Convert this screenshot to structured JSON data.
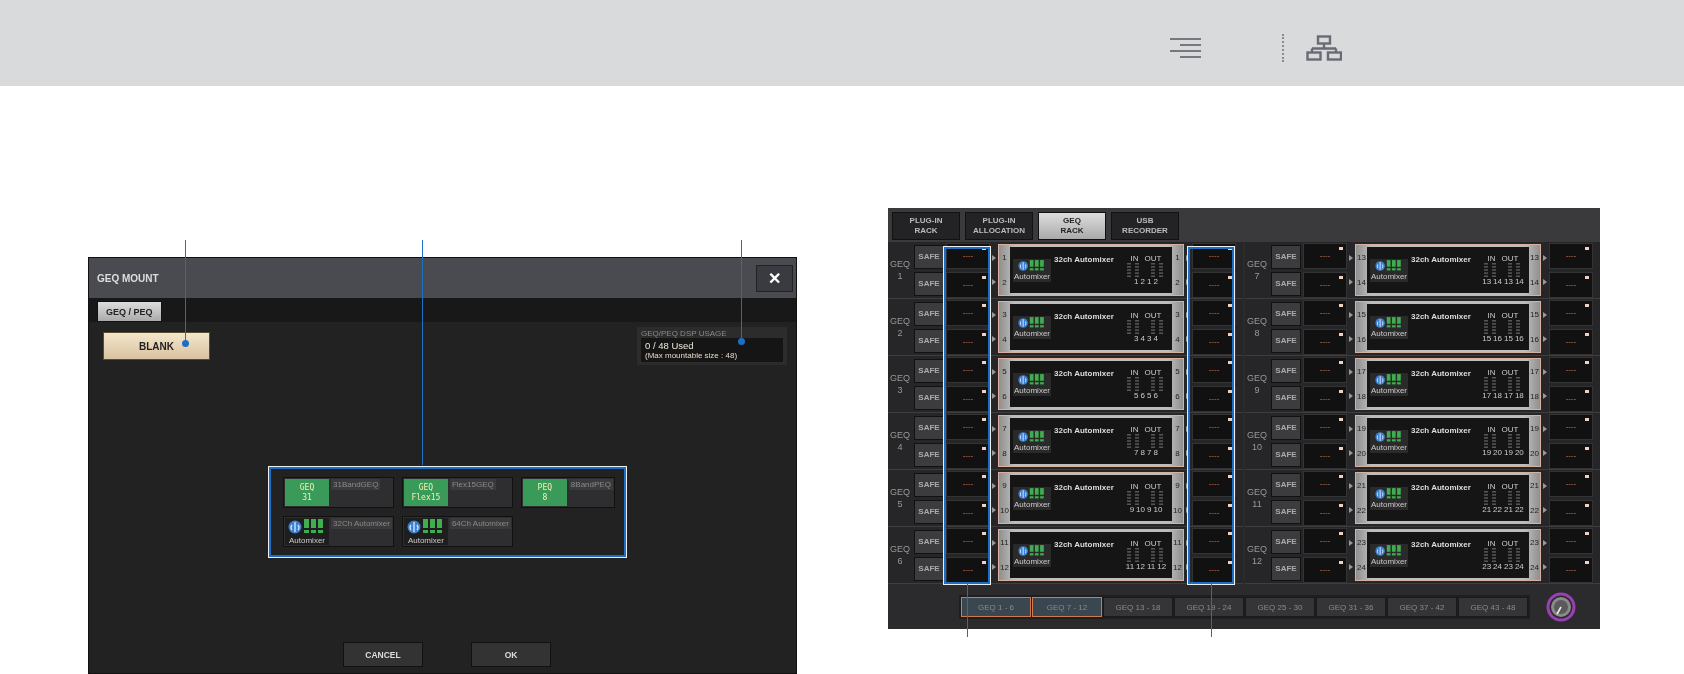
{
  "dialog": {
    "title": "GEQ MOUNT",
    "close": "✕",
    "tabs": [
      {
        "label": "GEQ / PEQ",
        "selected": true
      }
    ],
    "blank_button": "BLANK",
    "dsp_usage": {
      "title": "GEQ/PEQ DSP USAGE",
      "value": "0 / 48 Used",
      "note": "(Max mountable size : 48)"
    },
    "plugins": [
      {
        "kind": "eq",
        "logo": [
          "GEQ",
          "31"
        ],
        "name": "31BandGEQ"
      },
      {
        "kind": "eq",
        "logo": [
          "GEQ",
          "Flex15"
        ],
        "name": "Flex15GEQ"
      },
      {
        "kind": "eq",
        "logo": [
          "PEQ",
          "8"
        ],
        "name": "8BandPEQ"
      },
      {
        "kind": "automixer",
        "logo": [
          "Automixer"
        ],
        "name": "32Ch Automixer"
      },
      {
        "kind": "automixer",
        "logo": [
          "Automixer"
        ],
        "name": "64Ch Automixer"
      }
    ],
    "buttons": [
      "CANCEL",
      "OK"
    ]
  },
  "rack": {
    "tabs": [
      {
        "label": [
          "PLUG-IN",
          "RACK"
        ],
        "selected": false
      },
      {
        "label": [
          "PLUG-IN",
          "ALLOCATION"
        ],
        "selected": false
      },
      {
        "label": [
          "GEQ",
          "RACK"
        ],
        "selected": true
      },
      {
        "label": [
          "USB",
          "RECORDER"
        ],
        "selected": false
      }
    ],
    "columns": [
      {
        "units": [
          {
            "label": "GEQ",
            "number": "1",
            "safe": [
              "SAFE",
              "SAFE"
            ],
            "inputs": [
              "----",
              "----"
            ],
            "in_channels": [
              "1",
              "2"
            ],
            "module": "32ch Automixer",
            "logo": "Automixer",
            "in": "IN",
            "out": "OUT",
            "meter": [
              "1",
              "2",
              "1",
              "2"
            ],
            "out_channels": [
              "1",
              "2"
            ],
            "outputs": [
              "----",
              "----"
            ]
          },
          {
            "label": "GEQ",
            "number": "2",
            "safe": [
              "SAFE",
              "SAFE"
            ],
            "inputs": [
              "----",
              "----"
            ],
            "in_channels": [
              "3",
              "4"
            ],
            "module": "32ch Automixer",
            "logo": "Automixer",
            "in": "IN",
            "out": "OUT",
            "meter": [
              "3",
              "4",
              "3",
              "4"
            ],
            "out_channels": [
              "3",
              "4"
            ],
            "outputs": [
              "----",
              "----"
            ]
          },
          {
            "label": "GEQ",
            "number": "3",
            "safe": [
              "SAFE",
              "SAFE"
            ],
            "inputs": [
              "----",
              "----"
            ],
            "in_channels": [
              "5",
              "6"
            ],
            "module": "32ch Automixer",
            "logo": "Automixer",
            "in": "IN",
            "out": "OUT",
            "meter": [
              "5",
              "6",
              "5",
              "6"
            ],
            "out_channels": [
              "5",
              "6"
            ],
            "outputs": [
              "----",
              "----"
            ]
          },
          {
            "label": "GEQ",
            "number": "4",
            "safe": [
              "SAFE",
              "SAFE"
            ],
            "inputs": [
              "----",
              "----"
            ],
            "in_channels": [
              "7",
              "8"
            ],
            "module": "32ch Automixer",
            "logo": "Automixer",
            "in": "IN",
            "out": "OUT",
            "meter": [
              "7",
              "8",
              "7",
              "8"
            ],
            "out_channels": [
              "7",
              "8"
            ],
            "outputs": [
              "----",
              "----"
            ]
          },
          {
            "label": "GEQ",
            "number": "5",
            "safe": [
              "SAFE",
              "SAFE"
            ],
            "inputs": [
              "----",
              "----"
            ],
            "in_channels": [
              "9",
              "10"
            ],
            "module": "32ch Automixer",
            "logo": "Automixer",
            "in": "IN",
            "out": "OUT",
            "meter": [
              "9",
              "10",
              "9",
              "10"
            ],
            "out_channels": [
              "9",
              "10"
            ],
            "outputs": [
              "----",
              "----"
            ]
          },
          {
            "label": "GEQ",
            "number": "6",
            "safe": [
              "SAFE",
              "SAFE"
            ],
            "inputs": [
              "----",
              "----"
            ],
            "in_channels": [
              "11",
              "12"
            ],
            "module": "32ch Automixer",
            "logo": "Automixer",
            "in": "IN",
            "out": "OUT",
            "meter": [
              "11",
              "12",
              "11",
              "12"
            ],
            "out_channels": [
              "11",
              "12"
            ],
            "outputs": [
              "----",
              "----"
            ]
          }
        ]
      },
      {
        "units": [
          {
            "label": "GEQ",
            "number": "7",
            "safe": [
              "SAFE",
              "SAFE"
            ],
            "inputs": [
              "----",
              "----"
            ],
            "in_channels": [
              "13",
              "14"
            ],
            "module": "32ch Automixer",
            "logo": "Automixer",
            "in": "IN",
            "out": "OUT",
            "meter": [
              "13",
              "14",
              "13",
              "14"
            ],
            "out_channels": [
              "13",
              "14"
            ],
            "outputs": [
              "----",
              "----"
            ]
          },
          {
            "label": "GEQ",
            "number": "8",
            "safe": [
              "SAFE",
              "SAFE"
            ],
            "inputs": [
              "----",
              "----"
            ],
            "in_channels": [
              "15",
              "16"
            ],
            "module": "32ch Automixer",
            "logo": "Automixer",
            "in": "IN",
            "out": "OUT",
            "meter": [
              "15",
              "16",
              "15",
              "16"
            ],
            "out_channels": [
              "15",
              "16"
            ],
            "outputs": [
              "----",
              "----"
            ]
          },
          {
            "label": "GEQ",
            "number": "9",
            "safe": [
              "SAFE",
              "SAFE"
            ],
            "inputs": [
              "----",
              "----"
            ],
            "in_channels": [
              "17",
              "18"
            ],
            "module": "32ch Automixer",
            "logo": "Automixer",
            "in": "IN",
            "out": "OUT",
            "meter": [
              "17",
              "18",
              "17",
              "18"
            ],
            "out_channels": [
              "17",
              "18"
            ],
            "outputs": [
              "----",
              "----"
            ]
          },
          {
            "label": "GEQ",
            "number": "10",
            "safe": [
              "SAFE",
              "SAFE"
            ],
            "inputs": [
              "----",
              "----"
            ],
            "in_channels": [
              "19",
              "20"
            ],
            "module": "32ch Automixer",
            "logo": "Automixer",
            "in": "IN",
            "out": "OUT",
            "meter": [
              "19",
              "20",
              "19",
              "20"
            ],
            "out_channels": [
              "19",
              "20"
            ],
            "outputs": [
              "----",
              "----"
            ]
          },
          {
            "label": "GEQ",
            "number": "11",
            "safe": [
              "SAFE",
              "SAFE"
            ],
            "inputs": [
              "----",
              "----"
            ],
            "in_channels": [
              "21",
              "22"
            ],
            "module": "32ch Automixer",
            "logo": "Automixer",
            "in": "IN",
            "out": "OUT",
            "meter": [
              "21",
              "22",
              "21",
              "22"
            ],
            "out_channels": [
              "21",
              "22"
            ],
            "outputs": [
              "----",
              "----"
            ]
          },
          {
            "label": "GEQ",
            "number": "12",
            "safe": [
              "SAFE",
              "SAFE"
            ],
            "inputs": [
              "----",
              "----"
            ],
            "in_channels": [
              "23",
              "24"
            ],
            "module": "32ch Automixer",
            "logo": "Automixer",
            "in": "IN",
            "out": "OUT",
            "meter": [
              "23",
              "24",
              "23",
              "24"
            ],
            "out_channels": [
              "23",
              "24"
            ],
            "outputs": [
              "----",
              "----"
            ]
          }
        ]
      }
    ],
    "pages": [
      {
        "label": "GEQ 1 - 6",
        "selected": true
      },
      {
        "label": "GEQ 7 - 12",
        "selected": true
      },
      {
        "label": "GEQ 13 - 18",
        "selected": false
      },
      {
        "label": "GEQ 19 - 24",
        "selected": false
      },
      {
        "label": "GEQ 25 - 30",
        "selected": false
      },
      {
        "label": "GEQ 31 - 36",
        "selected": false
      },
      {
        "label": "GEQ 37 - 42",
        "selected": false
      },
      {
        "label": "GEQ 43 - 48",
        "selected": false
      }
    ]
  }
}
